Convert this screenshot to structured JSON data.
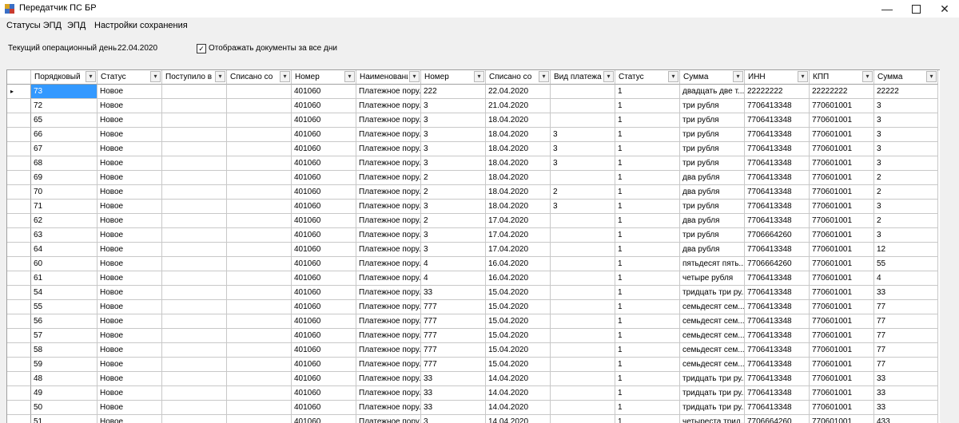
{
  "window": {
    "title": "Передатчик ПС БР",
    "minimize_icon": "minimize-icon",
    "maximize_icon": "maximize-icon",
    "close_icon": "close-icon"
  },
  "menu": [
    "Статусы ЭПД",
    "ЭПД",
    "Настройки сохранения"
  ],
  "info": {
    "day_label": "Текущий операционный день",
    "day_value": "22.04.2020",
    "show_all_label": "Отображать документы за все дни",
    "show_all_checked": true
  },
  "grid": {
    "columns": [
      "Порядковый",
      "Статус",
      "Поступило в",
      "Списано со",
      "Номер",
      "Наименовани",
      "Номер",
      "Списано со",
      "Вид платежа",
      "Статус",
      "Сумма",
      "ИНН",
      "КПП",
      "Сумма"
    ],
    "selected_row": 0,
    "current_row_marker": "▸",
    "rows": [
      [
        "73",
        "Новое",
        "",
        "",
        "401060",
        "Платежное пору...",
        "222",
        "22.04.2020",
        "",
        "1",
        "двадцать две т...",
        "22222222",
        "22222222",
        "22222"
      ],
      [
        "72",
        "Новое",
        "",
        "",
        "401060",
        "Платежное пору...",
        "3",
        "21.04.2020",
        "",
        "1",
        "три рубля",
        "7706413348",
        "770601001",
        "3"
      ],
      [
        "65",
        "Новое",
        "",
        "",
        "401060",
        "Платежное пору...",
        "3",
        "18.04.2020",
        "",
        "1",
        "три рубля",
        "7706413348",
        "770601001",
        "3"
      ],
      [
        "66",
        "Новое",
        "",
        "",
        "401060",
        "Платежное пору...",
        "3",
        "18.04.2020",
        "3",
        "1",
        "три рубля",
        "7706413348",
        "770601001",
        "3"
      ],
      [
        "67",
        "Новое",
        "",
        "",
        "401060",
        "Платежное пору...",
        "3",
        "18.04.2020",
        "3",
        "1",
        "три рубля",
        "7706413348",
        "770601001",
        "3"
      ],
      [
        "68",
        "Новое",
        "",
        "",
        "401060",
        "Платежное пору...",
        "3",
        "18.04.2020",
        "3",
        "1",
        "три рубля",
        "7706413348",
        "770601001",
        "3"
      ],
      [
        "69",
        "Новое",
        "",
        "",
        "401060",
        "Платежное пору...",
        "2",
        "18.04.2020",
        "",
        "1",
        "два рубля",
        "7706413348",
        "770601001",
        "2"
      ],
      [
        "70",
        "Новое",
        "",
        "",
        "401060",
        "Платежное пору...",
        "2",
        "18.04.2020",
        "2",
        "1",
        "два рубля",
        "7706413348",
        "770601001",
        "2"
      ],
      [
        "71",
        "Новое",
        "",
        "",
        "401060",
        "Платежное пору...",
        "3",
        "18.04.2020",
        "3",
        "1",
        "три рубля",
        "7706413348",
        "770601001",
        "3"
      ],
      [
        "62",
        "Новое",
        "",
        "",
        "401060",
        "Платежное пору...",
        "2",
        "17.04.2020",
        "",
        "1",
        "два рубля",
        "7706413348",
        "770601001",
        "2"
      ],
      [
        "63",
        "Новое",
        "",
        "",
        "401060",
        "Платежное пору...",
        "3",
        "17.04.2020",
        "",
        "1",
        "три рубля",
        "7706664260",
        "770601001",
        "3"
      ],
      [
        "64",
        "Новое",
        "",
        "",
        "401060",
        "Платежное пору...",
        "3",
        "17.04.2020",
        "",
        "1",
        "два рубля",
        "7706413348",
        "770601001",
        "12"
      ],
      [
        "60",
        "Новое",
        "",
        "",
        "401060",
        "Платежное пору...",
        "4",
        "16.04.2020",
        "",
        "1",
        "пятьдесят пять...",
        "7706664260",
        "770601001",
        "55"
      ],
      [
        "61",
        "Новое",
        "",
        "",
        "401060",
        "Платежное пору...",
        "4",
        "16.04.2020",
        "",
        "1",
        "четыре рубля",
        "7706413348",
        "770601001",
        "4"
      ],
      [
        "54",
        "Новое",
        "",
        "",
        "401060",
        "Платежное пору...",
        "33",
        "15.04.2020",
        "",
        "1",
        "тридцать три ру...",
        "7706413348",
        "770601001",
        "33"
      ],
      [
        "55",
        "Новое",
        "",
        "",
        "401060",
        "Платежное пору...",
        "777",
        "15.04.2020",
        "",
        "1",
        "семьдесят сем...",
        "7706413348",
        "770601001",
        "77"
      ],
      [
        "56",
        "Новое",
        "",
        "",
        "401060",
        "Платежное пору...",
        "777",
        "15.04.2020",
        "",
        "1",
        "семьдесят сем...",
        "7706413348",
        "770601001",
        "77"
      ],
      [
        "57",
        "Новое",
        "",
        "",
        "401060",
        "Платежное пору...",
        "777",
        "15.04.2020",
        "",
        "1",
        "семьдесят сем...",
        "7706413348",
        "770601001",
        "77"
      ],
      [
        "58",
        "Новое",
        "",
        "",
        "401060",
        "Платежное пору...",
        "777",
        "15.04.2020",
        "",
        "1",
        "семьдесят сем...",
        "7706413348",
        "770601001",
        "77"
      ],
      [
        "59",
        "Новое",
        "",
        "",
        "401060",
        "Платежное пору...",
        "777",
        "15.04.2020",
        "",
        "1",
        "семьдесят сем...",
        "7706413348",
        "770601001",
        "77"
      ],
      [
        "48",
        "Новое",
        "",
        "",
        "401060",
        "Платежное пору...",
        "33",
        "14.04.2020",
        "",
        "1",
        "тридцать три ру...",
        "7706413348",
        "770601001",
        "33"
      ],
      [
        "49",
        "Новое",
        "",
        "",
        "401060",
        "Платежное пору...",
        "33",
        "14.04.2020",
        "",
        "1",
        "тридцать три ру...",
        "7706413348",
        "770601001",
        "33"
      ],
      [
        "50",
        "Новое",
        "",
        "",
        "401060",
        "Платежное пору...",
        "33",
        "14.04.2020",
        "",
        "1",
        "тридцать три ру...",
        "7706413348",
        "770601001",
        "33"
      ],
      [
        "51",
        "Новое",
        "",
        "",
        "401060",
        "Платежное пору...",
        "3",
        "14.04.2020",
        "",
        "1",
        "четыреста трид...",
        "7706664260",
        "770601001",
        "433"
      ]
    ]
  }
}
